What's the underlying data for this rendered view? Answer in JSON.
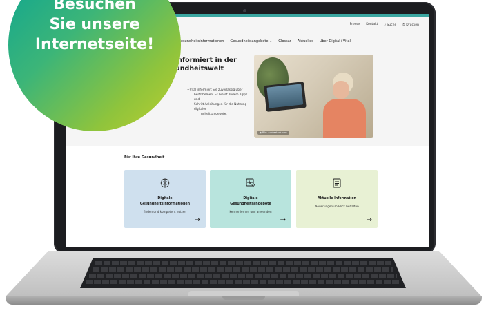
{
  "badge": {
    "lines": [
      "Besuchen",
      "Sie unsere",
      "Internetseite!"
    ]
  },
  "website": {
    "utility_nav": [
      "Presse",
      "Kontakt",
      "Suche",
      "Drucken"
    ],
    "main_nav": [
      "Gesundheitsinformationen",
      "Gesundheitsangebote",
      "Glossar",
      "Aktuelles",
      "Über Digital+Vital"
    ],
    "hero": {
      "title": "informiert in der",
      "title_line2": "undheitswelt",
      "text_lines": [
        "+Vital informiert Sie zuverlässig über",
        "heitsthemen. Es bietet zudem Tipps und",
        "Schritt-Anleitungen für die Nutzung digitaler",
        "ndheitsangebote."
      ],
      "image_caption": "Bild: Adobestock.com"
    },
    "section_title": "Für Ihre Gesundheit",
    "cards": [
      {
        "icon": "brain-icon",
        "title_line1": "Digitale",
        "title_line2": "Gesundheitsinformationen",
        "subtitle": "finden und kompetent nutzen",
        "arrow": "→"
      },
      {
        "icon": "device-heart-icon",
        "title_line1": "Digitale",
        "title_line2": "Gesundheitsangebote",
        "subtitle": "kennenlernen und anwenden",
        "arrow": "→"
      },
      {
        "icon": "document-icon",
        "title_line1": "Aktuelle Information",
        "title_line2": "",
        "subtitle": "Neuerungen im Blick behalten",
        "arrow": "→"
      }
    ]
  },
  "colors": {
    "accent_teal": "#3aa6a0",
    "card_blue": "#cfe0ee",
    "card_teal": "#b8e4dd",
    "card_green": "#e8f1d4",
    "badge_start": "#0aa493",
    "badge_end": "#c0cf2e"
  }
}
